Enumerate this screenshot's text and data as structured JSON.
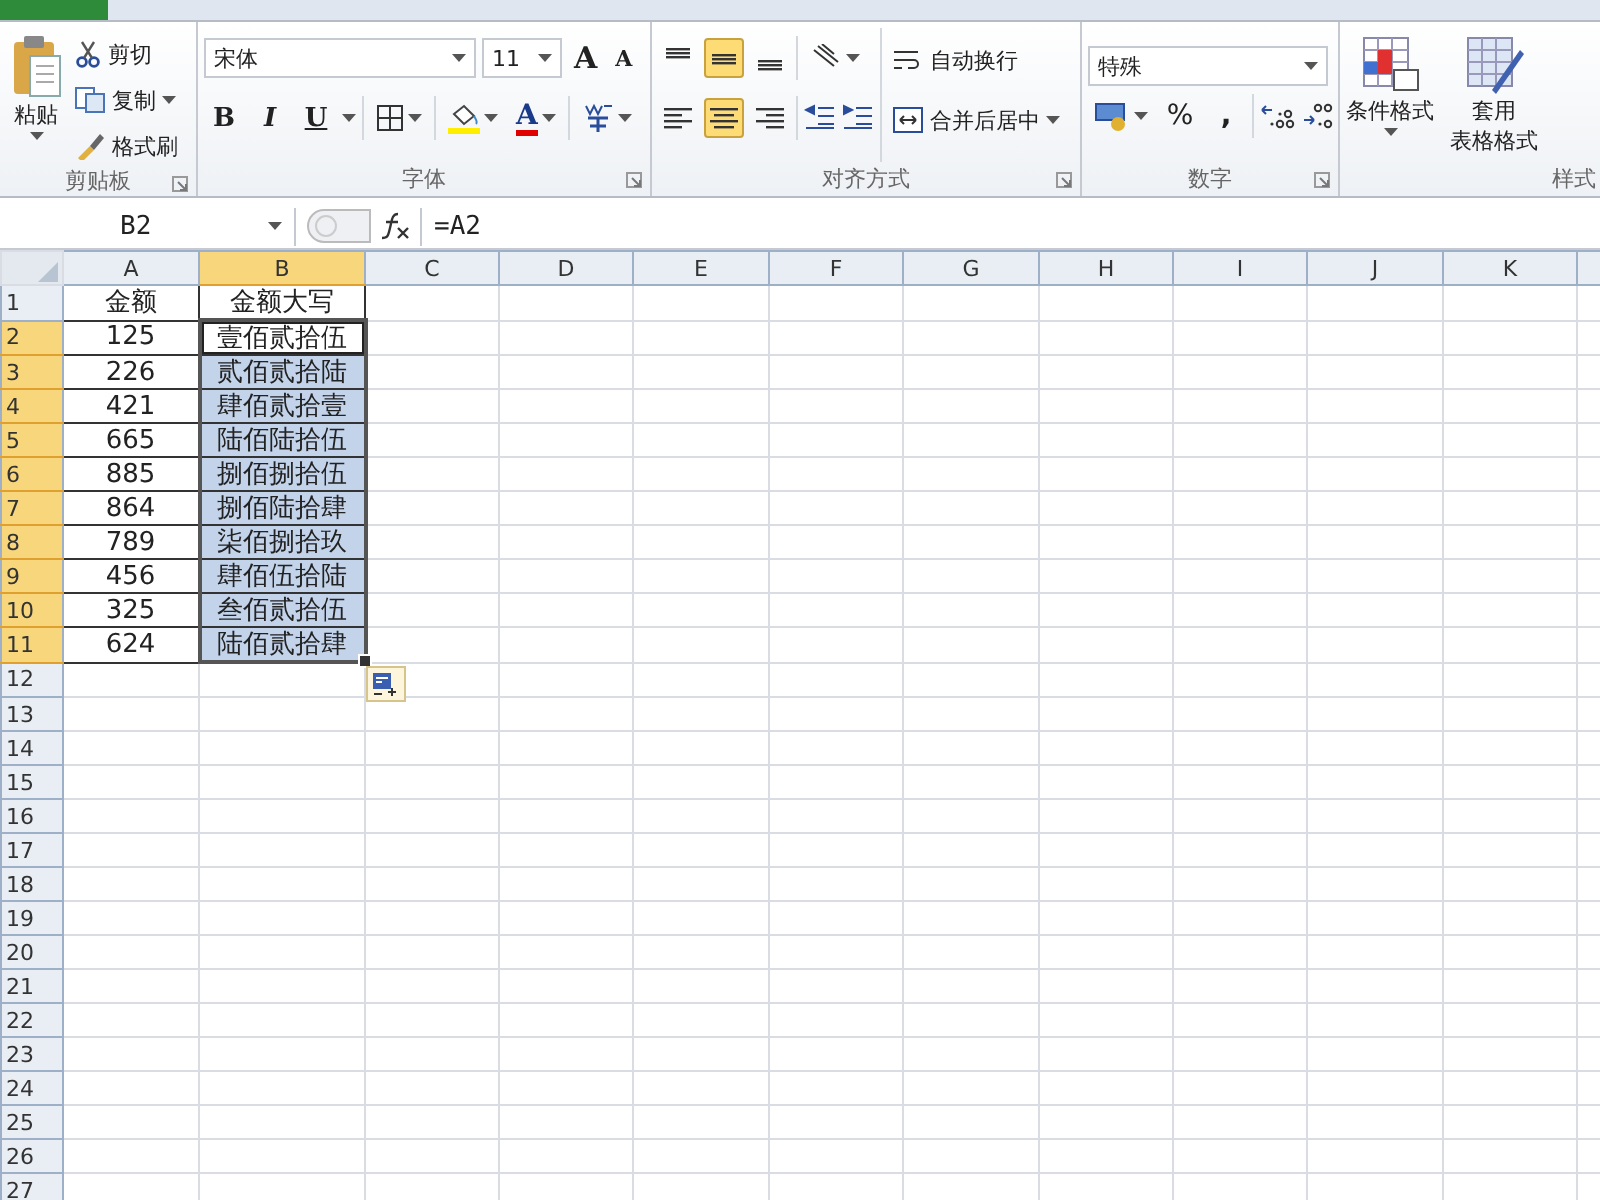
{
  "ribbon": {
    "groups": [
      {
        "kind": "clipboard",
        "label": "剪贴板",
        "paste": "粘贴",
        "items": [
          {
            "label": "剪切",
            "dropdown": false
          },
          {
            "label": "复制",
            "dropdown": true
          },
          {
            "label": "格式刷",
            "dropdown": false
          }
        ]
      },
      {
        "kind": "font",
        "label": "字体",
        "font_name": "宋体",
        "font_size": "11",
        "grow": "A",
        "shrink": "A",
        "styles": [
          "B",
          "I",
          "U"
        ],
        "font_color_letter": "A"
      },
      {
        "kind": "alignment",
        "label": "对齐方式",
        "vertical": [
          {
            "selected": false
          },
          {
            "selected": true
          },
          {
            "selected": false
          }
        ],
        "horizontal": [
          {
            "selected": false
          },
          {
            "selected": true
          },
          {
            "selected": false
          }
        ],
        "wrap": "自动换行",
        "merge": "合并后居中"
      },
      {
        "kind": "number",
        "label": "数字",
        "format": "特殊",
        "percent": "%",
        "comma": ","
      },
      {
        "kind": "styles",
        "label": "样式",
        "conditional": "条件格式",
        "table_format": [
          "套用",
          "表格格式"
        ]
      }
    ]
  },
  "formula_bar": {
    "name_box": "B2",
    "formula": "=A2"
  },
  "grid": {
    "columns": [
      {
        "label": "A",
        "selected": false
      },
      {
        "label": "B",
        "selected": true
      },
      {
        "label": "C",
        "selected": false
      },
      {
        "label": "D",
        "selected": false
      },
      {
        "label": "E",
        "selected": false
      },
      {
        "label": "F",
        "selected": false
      },
      {
        "label": "G",
        "selected": false
      },
      {
        "label": "H",
        "selected": false
      },
      {
        "label": "I",
        "selected": false
      },
      {
        "label": "J",
        "selected": false
      },
      {
        "label": "K",
        "selected": false
      }
    ],
    "rows": [
      {
        "header": "1",
        "selected": false,
        "cells": [
          {
            "text": "金额",
            "selected": false,
            "active": false
          },
          {
            "text": "金额大写",
            "selected": false,
            "active": false
          }
        ]
      },
      {
        "header": "2",
        "selected": true,
        "cells": [
          {
            "text": "125",
            "selected": false,
            "active": false
          },
          {
            "text": "壹佰贰拾伍",
            "selected": true,
            "active": true
          }
        ]
      },
      {
        "header": "3",
        "selected": true,
        "cells": [
          {
            "text": "226",
            "selected": false,
            "active": false
          },
          {
            "text": "贰佰贰拾陆",
            "selected": true,
            "active": false
          }
        ]
      },
      {
        "header": "4",
        "selected": true,
        "cells": [
          {
            "text": "421",
            "selected": false,
            "active": false
          },
          {
            "text": "肆佰贰拾壹",
            "selected": true,
            "active": false
          }
        ]
      },
      {
        "header": "5",
        "selected": true,
        "cells": [
          {
            "text": "665",
            "selected": false,
            "active": false
          },
          {
            "text": "陆佰陆拾伍",
            "selected": true,
            "active": false
          }
        ]
      },
      {
        "header": "6",
        "selected": true,
        "cells": [
          {
            "text": "885",
            "selected": false,
            "active": false
          },
          {
            "text": "捌佰捌拾伍",
            "selected": true,
            "active": false
          }
        ]
      },
      {
        "header": "7",
        "selected": true,
        "cells": [
          {
            "text": "864",
            "selected": false,
            "active": false
          },
          {
            "text": "捌佰陆拾肆",
            "selected": true,
            "active": false
          }
        ]
      },
      {
        "header": "8",
        "selected": true,
        "cells": [
          {
            "text": "789",
            "selected": false,
            "active": false
          },
          {
            "text": "柒佰捌拾玖",
            "selected": true,
            "active": false
          }
        ]
      },
      {
        "header": "9",
        "selected": true,
        "cells": [
          {
            "text": "456",
            "selected": false,
            "active": false
          },
          {
            "text": "肆佰伍拾陆",
            "selected": true,
            "active": false
          }
        ]
      },
      {
        "header": "10",
        "selected": true,
        "cells": [
          {
            "text": "325",
            "selected": false,
            "active": false
          },
          {
            "text": "叁佰贰拾伍",
            "selected": true,
            "active": false
          }
        ]
      },
      {
        "header": "11",
        "selected": true,
        "cells": [
          {
            "text": "624",
            "selected": false,
            "active": false
          },
          {
            "text": "陆佰贰拾肆",
            "selected": true,
            "active": false
          }
        ]
      },
      {
        "header": "12",
        "selected": false
      },
      {
        "header": "13",
        "selected": false
      },
      {
        "header": "14",
        "selected": false
      },
      {
        "header": "15",
        "selected": false
      },
      {
        "header": "16",
        "selected": false
      },
      {
        "header": "17",
        "selected": false
      },
      {
        "header": "18",
        "selected": false
      },
      {
        "header": "19",
        "selected": false
      },
      {
        "header": "20",
        "selected": false
      },
      {
        "header": "21",
        "selected": false
      },
      {
        "header": "22",
        "selected": false
      },
      {
        "header": "23",
        "selected": false
      },
      {
        "header": "24",
        "selected": false
      },
      {
        "header": "25",
        "selected": false
      },
      {
        "header": "26",
        "selected": false
      },
      {
        "header": "27",
        "selected": false
      }
    ]
  }
}
